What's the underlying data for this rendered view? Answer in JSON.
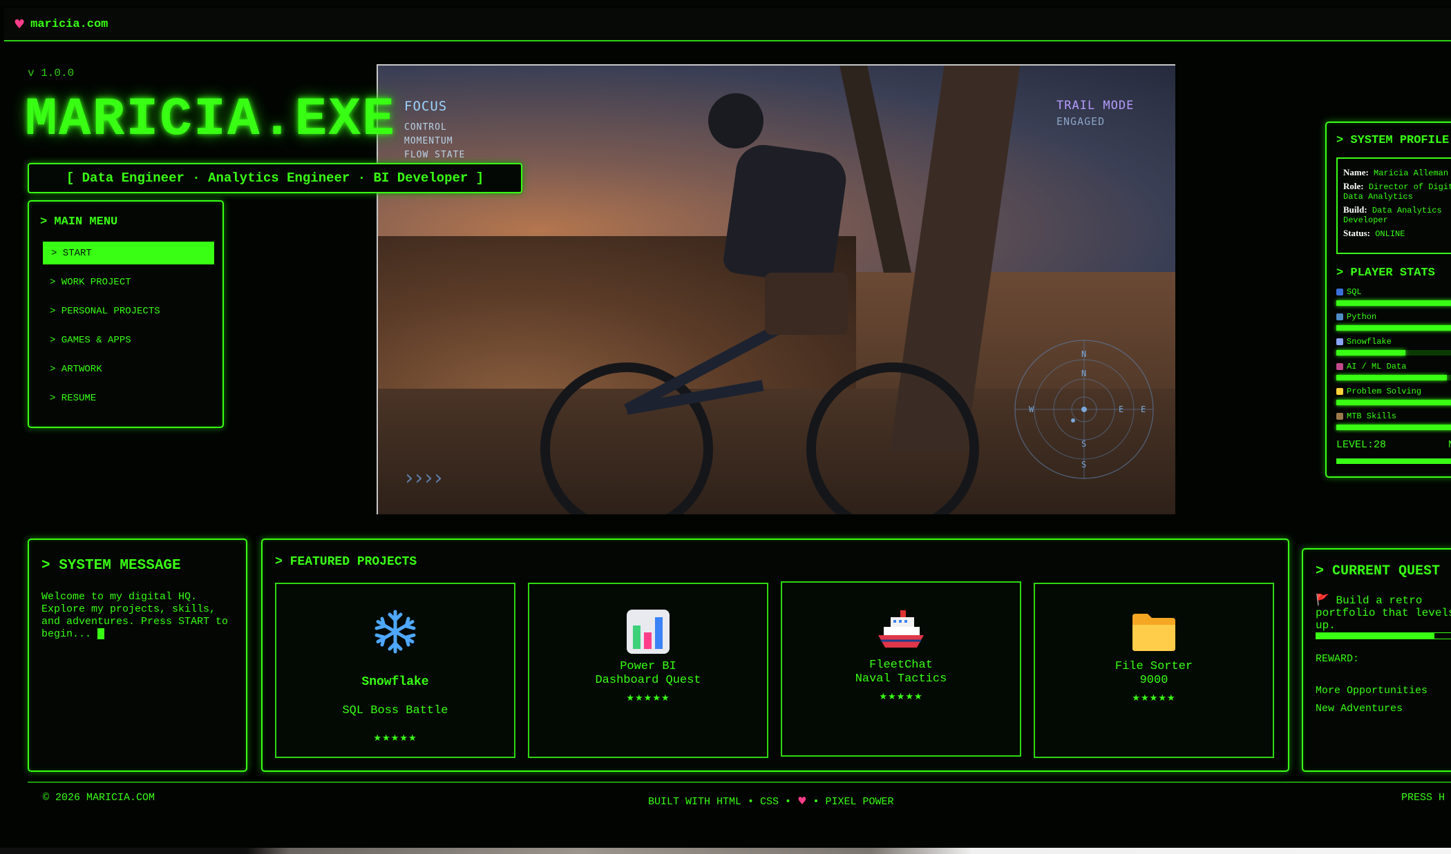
{
  "browser": {
    "url": "maricia.com"
  },
  "header": {
    "version": "v 1.0.0",
    "logo": "MARICIA.EXE",
    "tagline": "[ Data Engineer · Analytics Engineer · BI Developer ]"
  },
  "menu": {
    "title": "> MAIN MENU",
    "items": [
      {
        "label": "> START",
        "active": true
      },
      {
        "label": "> WORK PROJECT"
      },
      {
        "label": "> PERSONAL PROJECTS"
      },
      {
        "label": "> GAMES & APPS"
      },
      {
        "label": "> ARTWORK"
      },
      {
        "label": "> RESUME"
      }
    ]
  },
  "hero": {
    "focus": "FOCUS",
    "hud_lines": [
      "CONTROL",
      "MOMENTUM",
      "FLOW STATE"
    ],
    "trail_mode": "TRAIL MODE",
    "engaged": "ENGAGED",
    "arrows": "››››",
    "compass": {
      "n": "N",
      "s": "S",
      "e": "E",
      "w": "W"
    }
  },
  "profile": {
    "title": "> SYSTEM PROFILE",
    "fields": [
      {
        "key": "Name:",
        "value": "Maricia Alleman"
      },
      {
        "key": "Role:",
        "value": "Director of Digital",
        "value2": "Data Analytics"
      },
      {
        "key": "Build:",
        "value": "Data Analytics",
        "value2": "Developer"
      },
      {
        "key": "Status:",
        "value": "ONLINE"
      }
    ],
    "stats_title": "> PLAYER STATS",
    "stats": [
      {
        "label": "SQL",
        "level": 1.0,
        "icon_color": "#3b6fd8"
      },
      {
        "label": "Python",
        "level": 1.0,
        "icon_color": "#4f8cc9"
      },
      {
        "label": "Snowflake",
        "level": 0.5,
        "icon_color": "#8aa4ff"
      },
      {
        "label": "AI / ML Data",
        "level": 0.8,
        "icon_color": "#c24a8c"
      },
      {
        "label": "Problem Solving",
        "level": 1.0,
        "icon_color": "#ffd23a"
      },
      {
        "label": "MTB Skills",
        "level": 1.0,
        "icon_color": "#9c7a4a"
      }
    ],
    "level": "LEVEL:28",
    "next": "N"
  },
  "system_message": {
    "title": "> SYSTEM MESSAGE",
    "text": "Welcome to my digital HQ. Explore my projects, skills, and adventures. Press START to begin..."
  },
  "featured": {
    "title": "> FEATURED PROJECTS",
    "cards": [
      {
        "icon": "snowflake-icon",
        "line1": "Snowflake",
        "line2": "SQL Boss Battle",
        "stars": "★★★★★"
      },
      {
        "icon": "bar-chart-icon",
        "line1": "Power BI",
        "line2": "Dashboard Quest",
        "stars": "★★★★★"
      },
      {
        "icon": "ship-icon",
        "line1": "FleetChat",
        "line2": "Naval Tactics",
        "stars": "★★★★★"
      },
      {
        "icon": "folder-icon",
        "line1": "File Sorter",
        "line2": "9000",
        "stars": "★★★★★"
      }
    ]
  },
  "quest": {
    "title": "> CURRENT QUEST",
    "goal": "Build a retro portfolio that levels up.",
    "flag": "🚩",
    "progress": 0.75,
    "reward_label": "REWARD:",
    "rewards": [
      "More Opportunities",
      "New Adventures"
    ]
  },
  "footer": {
    "copyright": "© 2026 MARICIA.COM",
    "built_left": "BUILT WITH HTML • CSS •",
    "heart": "♥",
    "built_right": "• PIXEL POWER",
    "press": "PRESS H"
  },
  "colors": {
    "accent": "#39ff14",
    "background": "#020402",
    "heart": "#ff3d8b"
  }
}
